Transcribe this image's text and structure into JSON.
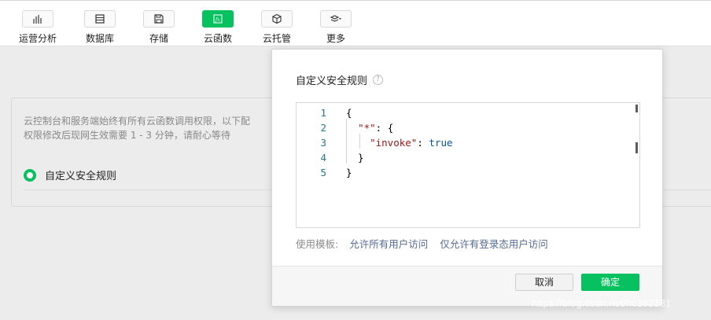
{
  "toolbar": {
    "items": [
      {
        "label": "运营分析",
        "icon": "bar-chart-icon"
      },
      {
        "label": "数据库",
        "icon": "database-icon"
      },
      {
        "label": "存储",
        "icon": "storage-icon"
      },
      {
        "label": "云函数",
        "icon": "function-icon",
        "active": true
      },
      {
        "label": "云托管",
        "icon": "cube-icon"
      },
      {
        "label": "更多",
        "icon": "layers-icon",
        "dropdown": true
      }
    ]
  },
  "panel": {
    "notice_line1": "云控制台和服务端始终有所有云函数调用权限，以下配",
    "notice_line2": "权限修改后现网生效需要 1 - 3 分钟，请耐心等待",
    "option_label": "自定义安全规则"
  },
  "dialog": {
    "title": "自定义安全规则",
    "help_icon_text": "?",
    "editor": {
      "lines": [
        {
          "num": "1",
          "tokens": [
            {
              "t": "{",
              "c": "punct"
            }
          ]
        },
        {
          "num": "2",
          "tokens": [
            {
              "t": "  ",
              "c": "punct"
            },
            {
              "t": "\"*\"",
              "c": "str"
            },
            {
              "t": ": {",
              "c": "punct"
            }
          ]
        },
        {
          "num": "3",
          "tokens": [
            {
              "t": "    ",
              "c": "punct"
            },
            {
              "t": "\"invoke\"",
              "c": "str"
            },
            {
              "t": ": ",
              "c": "punct"
            },
            {
              "t": "true",
              "c": "kw"
            }
          ]
        },
        {
          "num": "4",
          "tokens": [
            {
              "t": "  }",
              "c": "punct"
            }
          ]
        },
        {
          "num": "5",
          "tokens": [
            {
              "t": "}",
              "c": "punct"
            }
          ]
        }
      ]
    },
    "templates_label": "使用模板:",
    "template_links": [
      "允许所有用户访问",
      "仅允许有登录态用户访问"
    ],
    "cancel_label": "取消",
    "ok_label": "确定"
  },
  "watermark": "https://blog.csdn.net/hc162181",
  "colors": {
    "accent": "#07c160",
    "link": "#576b95",
    "string": "#a31515",
    "keyword": "#0451a5",
    "line_number": "#237893"
  }
}
